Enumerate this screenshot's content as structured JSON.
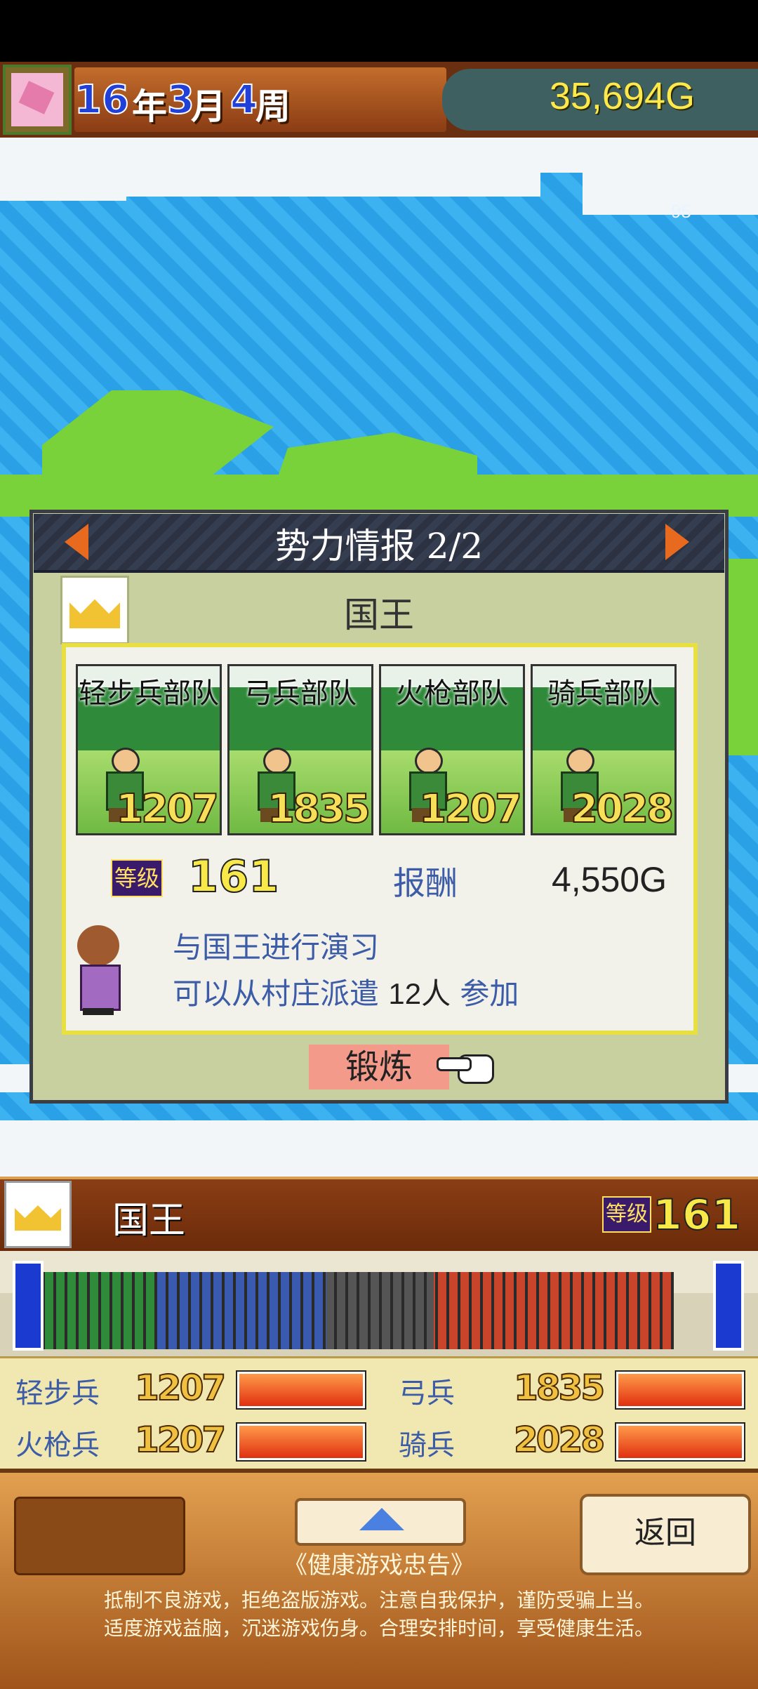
{
  "header": {
    "year_num": "16",
    "year_unit": "年",
    "month_num": "3",
    "month_unit": "月",
    "week_num": "4",
    "week_unit": "周",
    "gold": "35,694G"
  },
  "map": {
    "faded_text": "95"
  },
  "dialog": {
    "title": "势力情报 2/2",
    "name": "国王",
    "units": [
      {
        "label": "轻步兵部队",
        "value": "1207"
      },
      {
        "label": "弓兵部队",
        "value": "1835"
      },
      {
        "label": "火枪部队",
        "value": "1207"
      },
      {
        "label": "骑兵部队",
        "value": "2028"
      }
    ],
    "level_badge": "等级",
    "level_value": "161",
    "reward_label": "报酬",
    "reward_value": "4,550G",
    "message_line1": "与国王进行演习",
    "message_line2_a": "可以从村庄派遣 ",
    "message_line2_num": "12人",
    "message_line2_b": " 参加",
    "train_button": "锻炼"
  },
  "bottom": {
    "name": "国王",
    "level_badge": "等级",
    "level_value": "161",
    "stats": [
      {
        "label": "轻步兵",
        "value": "1207",
        "fill": 1.0
      },
      {
        "label": "弓兵",
        "value": "1835",
        "fill": 1.0
      },
      {
        "label": "火枪兵",
        "value": "1207",
        "fill": 1.0
      },
      {
        "label": "骑兵",
        "value": "2028",
        "fill": 1.0
      }
    ],
    "back_button": "返回",
    "advice_title": "《健康游戏忠告》",
    "advice_line1": "抵制不良游戏，拒绝盗版游戏。注意自我保护，谨防受骗上当。",
    "advice_line2": "适度游戏益脑，沉迷游戏伤身。合理安排时间，享受健康生活。"
  },
  "colors": {
    "gold_text": "#ffe84a",
    "link_blue": "#3d5ca8",
    "accent_orange": "#e76a1e"
  }
}
